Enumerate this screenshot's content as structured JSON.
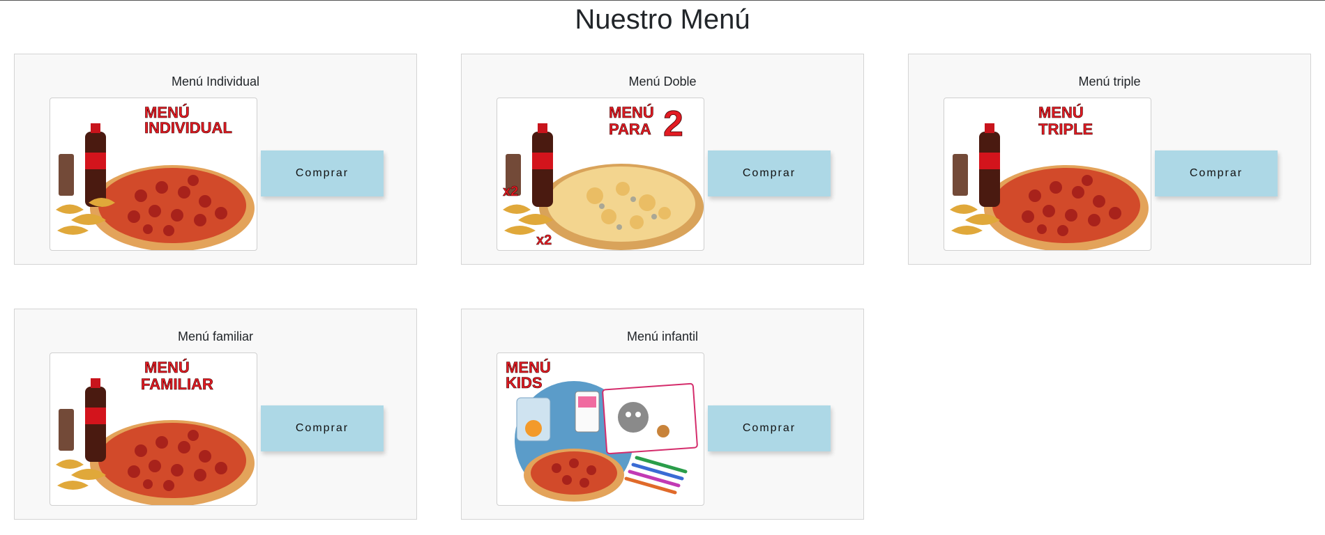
{
  "page": {
    "title": "Nuestro Menú"
  },
  "menus": [
    {
      "title": "Menú Individual",
      "button_label": "Comprar",
      "promo_lines": [
        "MENÚ",
        "INDIVIDUAL"
      ],
      "image_theme": "pepperoni-pizza-single"
    },
    {
      "title": "Menú Doble",
      "button_label": "Comprar",
      "promo_lines": [
        "MENÚ",
        "PARA",
        "2"
      ],
      "promo_extra": [
        "x2",
        "x2"
      ],
      "image_theme": "four-cheese-pizza-double"
    },
    {
      "title": "Menú triple",
      "button_label": "Comprar",
      "promo_lines": [
        "MENÚ",
        "TRIPLE"
      ],
      "image_theme": "pepperoni-pizza-triple"
    },
    {
      "title": "Menú familiar",
      "button_label": "Comprar",
      "promo_lines": [
        "MENÚ",
        "FAMILIAR"
      ],
      "image_theme": "pepperoni-pizza-family"
    },
    {
      "title": "Menú infantil",
      "button_label": "Comprar",
      "promo_lines": [
        "MENÚ",
        "KIDS"
      ],
      "image_theme": "kids-menu"
    }
  ],
  "colors": {
    "button_bg": "#add8e6",
    "card_bg": "#f8f8f8",
    "promo_red": "#e31b23"
  }
}
